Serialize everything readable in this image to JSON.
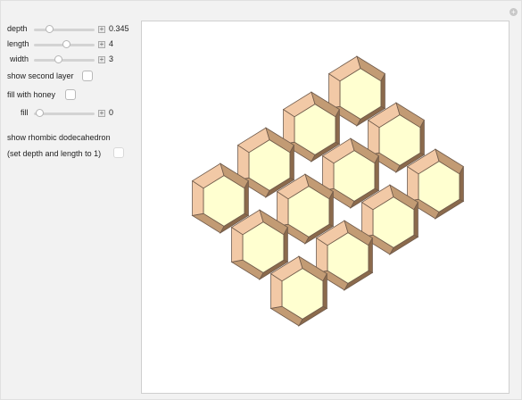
{
  "controls": {
    "depth": {
      "label": "depth",
      "value": 0.345,
      "display": "0.345",
      "fraction": 0.2
    },
    "length": {
      "label": "length",
      "value": 4,
      "display": "4",
      "fraction": 0.55
    },
    "width": {
      "label": "width",
      "value": 3,
      "display": "3",
      "fraction": 0.38
    },
    "show_second_layer": {
      "label": "show second layer",
      "checked": false
    },
    "fill_with_honey": {
      "label": "fill with honey",
      "checked": false
    },
    "fill": {
      "label": "fill",
      "value": 0,
      "display": "0",
      "fraction": 0
    },
    "show_rhombic_line1": "show rhombic dodecahedron",
    "show_rhombic_line2": "(set depth  and length to 1)",
    "show_rhombic": {
      "checked": false,
      "enabled": false
    }
  },
  "icons": {
    "reset": "reset-icon",
    "increment": "plus-icon"
  },
  "colors": {
    "cell_face": "#ffffd0",
    "wall_light": "#f2c9a6",
    "wall_mid": "#c29b74",
    "wall_dark": "#8b6a4c",
    "rim": "#6f5a4a"
  }
}
